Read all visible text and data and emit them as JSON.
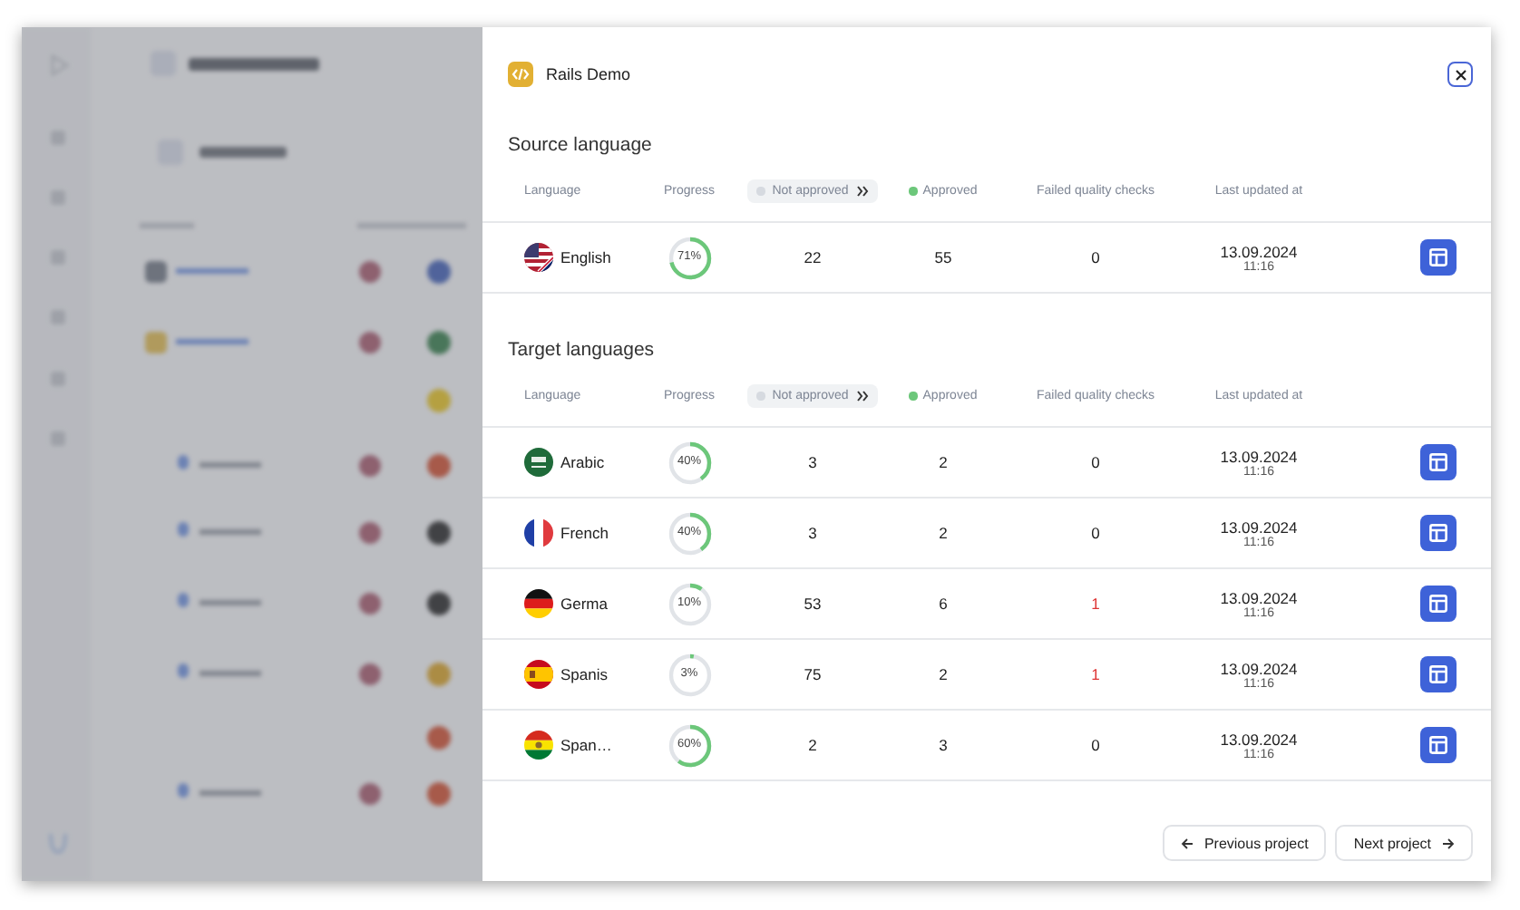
{
  "project": {
    "name": "Rails Demo"
  },
  "sections": [
    {
      "title": "Source language",
      "columns": [
        {
          "label": "Language",
          "kind": "plain"
        },
        {
          "label": "Progress",
          "kind": "plain"
        },
        {
          "label": "Not approved",
          "kind": "pill"
        },
        {
          "label": "Approved",
          "kind": "dot"
        },
        {
          "label": "Failed quality checks",
          "kind": "plain"
        },
        {
          "label": "Last updated at",
          "kind": "plain"
        }
      ],
      "rows": [
        {
          "kind": "us",
          "language": "English",
          "progress": "71%",
          "level": 0.71,
          "not_approved": "22",
          "approved": "55",
          "failed": "0",
          "alert": false,
          "date": "13.09.2024",
          "time": "11:16"
        }
      ]
    },
    {
      "title": "Target languages",
      "columns": [
        {
          "label": "Language",
          "kind": "plain"
        },
        {
          "label": "Progress",
          "kind": "plain"
        },
        {
          "label": "Not approved",
          "kind": "pill"
        },
        {
          "label": "Approved",
          "kind": "dot"
        },
        {
          "label": "Failed quality checks",
          "kind": "plain"
        },
        {
          "label": "Last updated at",
          "kind": "plain"
        }
      ],
      "rows": [
        {
          "kind": "sa",
          "language": "Arabic",
          "progress": "40%",
          "level": 0.4,
          "not_approved": "3",
          "approved": "2",
          "failed": "0",
          "alert": false,
          "date": "13.09.2024",
          "time": "11:16"
        },
        {
          "kind": "fr",
          "language": "French",
          "progress": "40%",
          "level": 0.4,
          "not_approved": "3",
          "approved": "2",
          "failed": "0",
          "alert": false,
          "date": "13.09.2024",
          "time": "11:16"
        },
        {
          "kind": "de",
          "language": "Germa",
          "progress": "10%",
          "level": 0.1,
          "not_approved": "53",
          "approved": "6",
          "failed": "1",
          "alert": true,
          "date": "13.09.2024",
          "time": "11:16"
        },
        {
          "kind": "es",
          "language": "Spanis",
          "progress": "3%",
          "level": 0.03,
          "not_approved": "75",
          "approved": "2",
          "failed": "1",
          "alert": true,
          "date": "13.09.2024",
          "time": "11:16"
        },
        {
          "kind": "bo",
          "language": "Span…",
          "progress": "60%",
          "level": 0.6,
          "not_approved": "2",
          "approved": "3",
          "failed": "0",
          "alert": false,
          "date": "13.09.2024",
          "time": "11:16"
        }
      ]
    }
  ],
  "footer_buttons": [
    {
      "label": "Previous project",
      "kind": "previous"
    },
    {
      "label": "Next project",
      "kind": "next"
    }
  ]
}
